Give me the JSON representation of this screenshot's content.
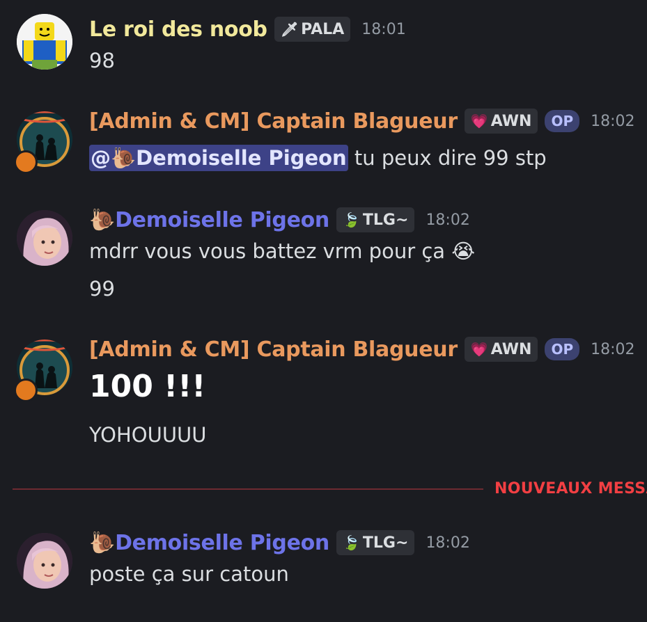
{
  "messages": [
    {
      "username": "Le roi des noob",
      "tag": {
        "icon": "sword-icon",
        "glyph": "🗡",
        "label": "PALA"
      },
      "time": "18:01",
      "lines": [
        "98"
      ]
    },
    {
      "username": "[Admin & CM] Captain Blagueur",
      "tag": {
        "icon": "pink-gem-icon",
        "glyph": "💗",
        "label": "AWN"
      },
      "op": "OP",
      "time": "18:02",
      "mention": "@🐌Demoiselle Pigeon",
      "lines": [
        "tu peux dire 99 stp"
      ]
    },
    {
      "username_emoji": "🐌",
      "username": "Demoiselle Pigeon",
      "tag": {
        "icon": "leaf-icon",
        "glyph": "🍃",
        "label": "TLG~"
      },
      "time": "18:02",
      "lines": [
        "mdrr vous vous battez vrm pour ça 😭",
        "99"
      ]
    },
    {
      "username": "[Admin & CM] Captain Blagueur",
      "tag": {
        "icon": "pink-gem-icon",
        "glyph": "💗",
        "label": "AWN"
      },
      "op": "OP",
      "time": "18:02",
      "lines": [
        "100 !!!",
        "YOHOUUUU"
      ]
    },
    {
      "username_emoji": "🐌",
      "username": "Demoiselle Pigeon",
      "tag": {
        "icon": "leaf-icon",
        "glyph": "🍃",
        "label": "TLG~"
      },
      "time": "18:02",
      "lines": [
        "poste ça sur catoun"
      ]
    }
  ],
  "divider": {
    "label": "NOUVEAUX MESSA"
  },
  "colors": {
    "background": "#1b1c21",
    "admin_name": "#e9995e",
    "noob_name": "#f1e89b",
    "pigeon_name": "#6d73e8",
    "new_messages": "#f23f43"
  }
}
